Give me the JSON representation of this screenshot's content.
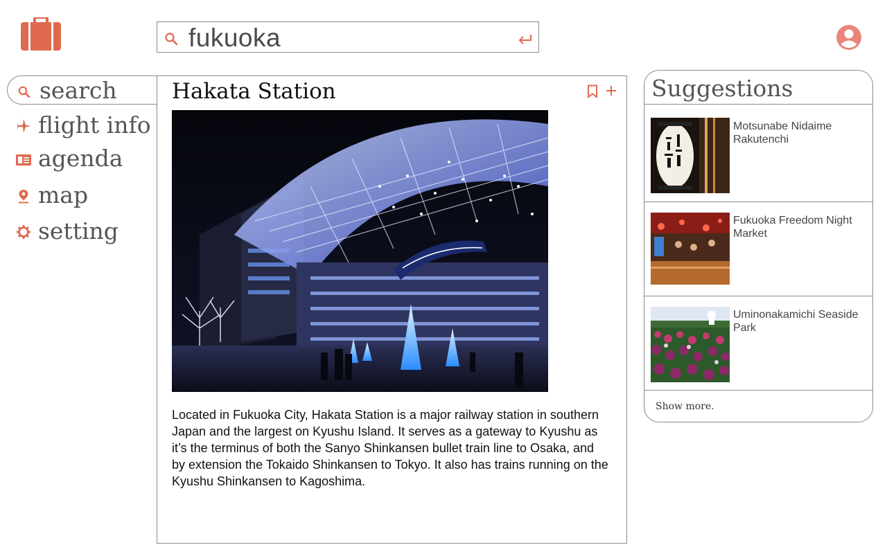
{
  "header": {
    "search_value": "fukuoka"
  },
  "sidebar": {
    "search_label": "search",
    "items": [
      {
        "label": "flight info",
        "icon": "airplane-icon"
      },
      {
        "label": "agenda",
        "icon": "agenda-icon"
      },
      {
        "label": "map",
        "icon": "map-pin-icon"
      },
      {
        "label": "setting",
        "icon": "gear-icon"
      }
    ]
  },
  "main": {
    "title": "Hakata Station",
    "description": "Located in Fukuoka City, Hakata Station is a major railway station in southern Japan and the largest on Kyushu Island. It serves as a gateway to Kyushu as it’s the terminus of both the Sanyo Shinkansen bullet train line to Osaka, and by extension the Tokaido Shinkansen to Tokyo. It also has trains running on the Kyushu Shinkansen to Kagoshima."
  },
  "suggestions": {
    "title": "Suggestions",
    "items": [
      {
        "name": "Motsunabe Nidaime Rakutenchi"
      },
      {
        "name": "Fukuoka Freedom Night Market"
      },
      {
        "name": "Uminonakamichi Seaside Park"
      }
    ],
    "show_more": "Show more."
  },
  "colors": {
    "accent": "#e06a4f",
    "border": "#8a8a8a"
  }
}
